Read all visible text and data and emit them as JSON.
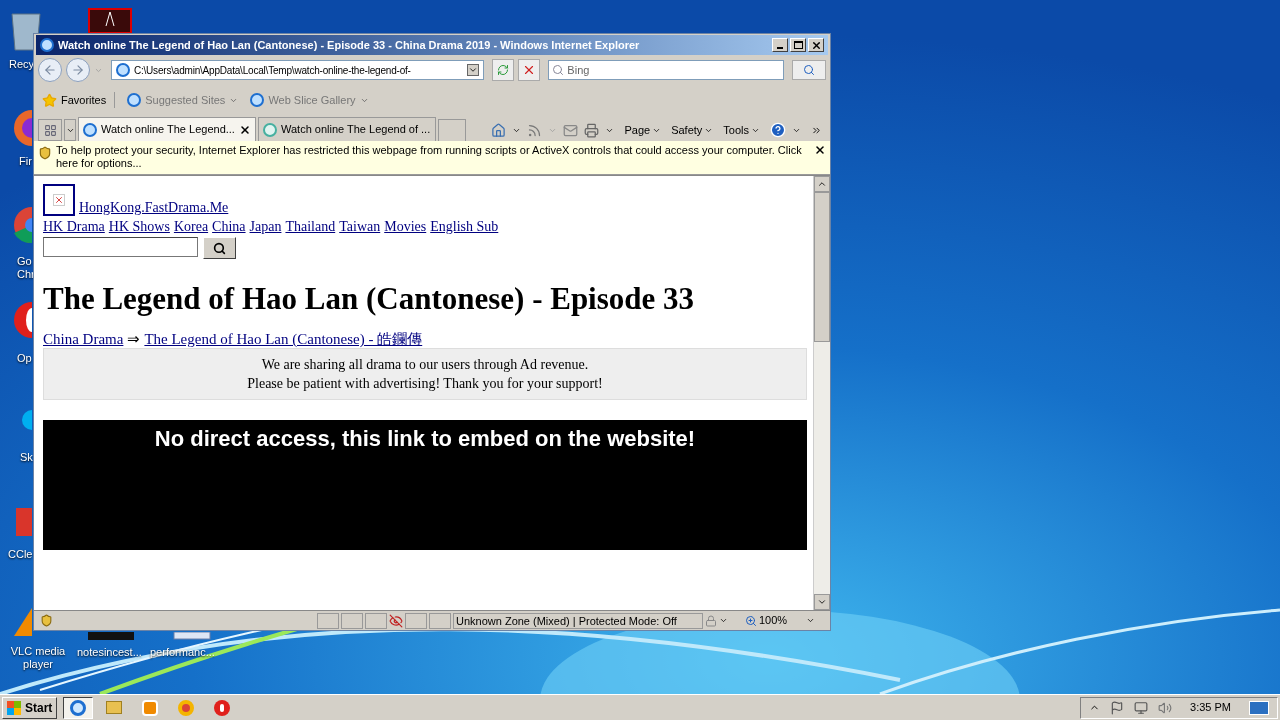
{
  "desktop_icons": [
    {
      "kind": "recycle-bin",
      "lines": [
        "Recy"
      ]
    },
    {
      "kind": "acrobat"
    },
    {
      "kind": "firefox",
      "lines": [
        "Fir"
      ]
    },
    {
      "kind": "chrome",
      "lines": [
        "Go",
        "Chr"
      ]
    },
    {
      "kind": "opera",
      "lines": [
        "Op"
      ]
    },
    {
      "kind": "skype",
      "lines": [
        "Sk"
      ]
    },
    {
      "kind": "ccleaner",
      "lines": [
        "CCle"
      ]
    },
    {
      "kind": "vlc",
      "lines": [
        "VLC media",
        "player"
      ]
    },
    {
      "kind": "document",
      "lines": [
        "notesincest..."
      ]
    },
    {
      "kind": "performance",
      "lines": [
        "performanc..."
      ]
    }
  ],
  "window": {
    "title": "Watch online The Legend of Hao Lan (Cantonese) - Episode 33 - China Drama 2019 - Windows Internet Explorer",
    "address": "C:\\Users\\admin\\AppData\\Local\\Temp\\watch-online-the-legend-of-",
    "search_placeholder": "Bing",
    "favorites_bar": [
      {
        "kind": "favorites",
        "label": "Favorites"
      },
      {
        "kind": "suggested",
        "label": "Suggested Sites"
      },
      {
        "kind": "slice",
        "label": "Web Slice Gallery"
      }
    ],
    "tabs": [
      {
        "label": "Watch online The Legend...",
        "selected": true
      },
      {
        "label": "Watch online The Legend of ...",
        "selected": false
      }
    ],
    "command_menus": [
      "Page",
      "Safety",
      "Tools"
    ],
    "info_bar": "To help protect your security, Internet Explorer has restricted this webpage from running scripts or ActiveX controls that could access your computer. Click here for options...",
    "status": {
      "zone": "Unknown Zone (Mixed) | Protected Mode: Off",
      "zoom": "100%"
    }
  },
  "page": {
    "site_link": "HongKong.FastDrama.Me",
    "nav": [
      "HK Drama",
      "HK Shows",
      "Korea",
      "China",
      "Japan",
      "Thailand",
      "Taiwan",
      "Movies",
      "English Sub"
    ],
    "heading": "The Legend of Hao Lan (Cantonese) - Episode 33",
    "breadcrumb": [
      {
        "kind": "link",
        "text": "China Drama"
      },
      {
        "kind": "separator",
        "text": "⇒"
      },
      {
        "kind": "link",
        "text": "The Legend of Hao Lan (Cantonese) - 皓鑭傳"
      }
    ],
    "notice": [
      "We are sharing all drama to our users through Ad revenue.",
      "Please be patient with advertising! Thank you for your support!"
    ],
    "player_message": "No direct access, this link to embed on the website!"
  },
  "taskbar": {
    "start": "Start",
    "apps": [
      {
        "kind": "ie",
        "selected": true
      },
      {
        "kind": "explorer",
        "selected": false
      },
      {
        "kind": "media",
        "selected": false
      },
      {
        "kind": "chrome",
        "selected": false
      },
      {
        "kind": "opera",
        "selected": false
      }
    ],
    "clock": "3:35 PM"
  }
}
